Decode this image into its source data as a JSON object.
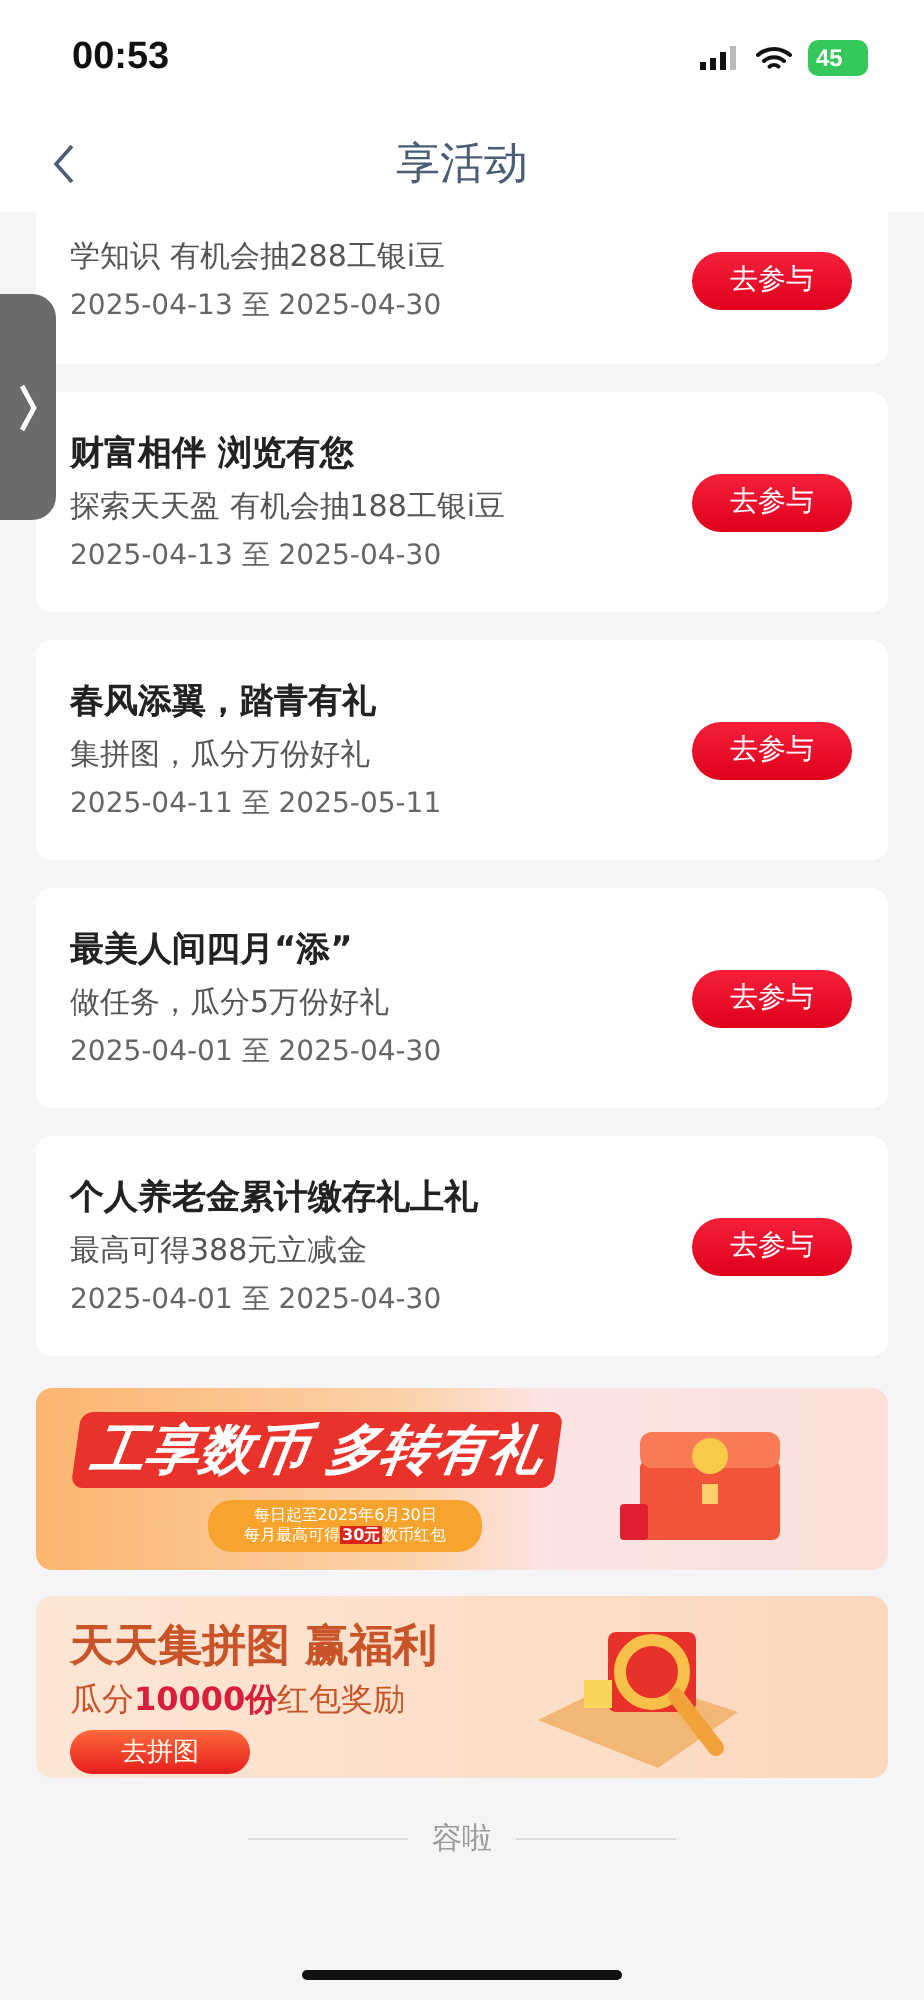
{
  "status_bar": {
    "time": "00:53",
    "battery": "45"
  },
  "nav": {
    "title": "享活动"
  },
  "activities": [
    {
      "subtitle": "学知识 有机会抽288工银i豆",
      "dates": "2025-04-13 至 2025-04-30",
      "button": "去参与",
      "clipped": true
    },
    {
      "title": "财富相伴 浏览有您",
      "subtitle": "探索天天盈 有机会抽188工银i豆",
      "dates": "2025-04-13 至 2025-04-30",
      "button": "去参与",
      "clipped": false
    },
    {
      "title": "春风添翼，踏青有礼",
      "subtitle": "集拼图，瓜分万份好礼",
      "dates": "2025-04-11 至 2025-05-11",
      "button": "去参与",
      "clipped": false
    },
    {
      "title": "最美人间四月“添”",
      "subtitle": "做任务，瓜分5万份好礼",
      "dates": "2025-04-01 至 2025-04-30",
      "button": "去参与",
      "clipped": false
    },
    {
      "title": "个人养老金累计缴存礼上礼",
      "subtitle": "最高可得388元立减金",
      "dates": "2025-04-01 至 2025-04-30",
      "button": "去参与",
      "clipped": false
    }
  ],
  "banners": [
    {
      "kind": "coin",
      "title": "工享数币 多转有礼",
      "lines": [
        "每日起至2025年6月30日",
        "每月最高可得**30元**数币红包"
      ]
    },
    {
      "kind": "puzzle",
      "title": "天天集拼图 赢福利",
      "subtitle": "瓜分**10000份**红包奖励",
      "button": "去拼图"
    }
  ],
  "footer": {
    "text": "容啦"
  }
}
